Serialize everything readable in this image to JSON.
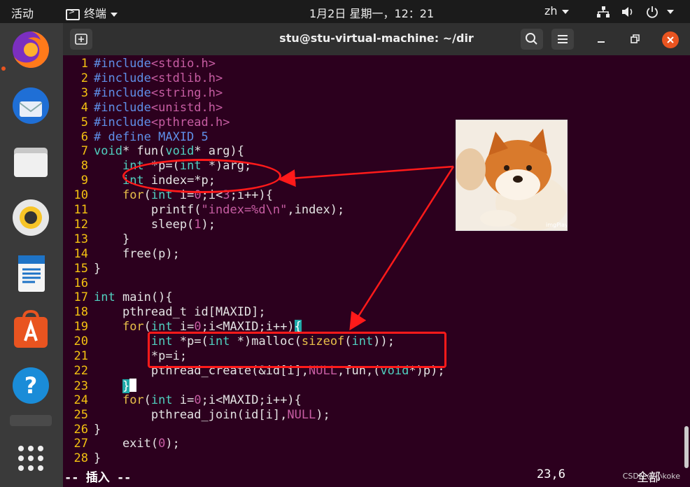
{
  "topbar": {
    "activities": "活动",
    "app_menu": "终端",
    "clock": "1月2日 星期一，12：21",
    "language": "zh"
  },
  "window": {
    "title": "stu@stu-virtual-machine: ~/dir"
  },
  "code": {
    "lines": [
      {
        "n": "1",
        "parts": [
          [
            "pre",
            "#include"
          ],
          [
            "hdr",
            "<stdio.h>"
          ]
        ]
      },
      {
        "n": "2",
        "parts": [
          [
            "pre",
            "#include"
          ],
          [
            "hdr",
            "<stdlib.h>"
          ]
        ]
      },
      {
        "n": "3",
        "parts": [
          [
            "pre",
            "#include"
          ],
          [
            "hdr",
            "<string.h>"
          ]
        ]
      },
      {
        "n": "4",
        "parts": [
          [
            "pre",
            "#include"
          ],
          [
            "hdr",
            "<unistd.h>"
          ]
        ]
      },
      {
        "n": "5",
        "parts": [
          [
            "pre",
            "#include"
          ],
          [
            "hdr",
            "<pthread.h>"
          ]
        ]
      },
      {
        "n": "6",
        "parts": [
          [
            "pre",
            "# define MAXID 5"
          ]
        ]
      },
      {
        "n": "7",
        "parts": [
          [
            "typ",
            "void"
          ],
          [
            "",
            "* fun("
          ],
          [
            "typ",
            "void"
          ],
          [
            "",
            "* arg){"
          ]
        ]
      },
      {
        "n": "8",
        "parts": [
          [
            "",
            "    "
          ],
          [
            "typ",
            "int"
          ],
          [
            "",
            " *p=("
          ],
          [
            "typ",
            "int"
          ],
          [
            "",
            " *)arg;"
          ]
        ]
      },
      {
        "n": "9",
        "parts": [
          [
            "",
            "    "
          ],
          [
            "typ",
            "int"
          ],
          [
            "",
            " index=*p;"
          ]
        ]
      },
      {
        "n": "10",
        "parts": [
          [
            "",
            "    "
          ],
          [
            "kw",
            "for"
          ],
          [
            "",
            "("
          ],
          [
            "typ",
            "int"
          ],
          [
            "",
            " i="
          ],
          [
            "num",
            "0"
          ],
          [
            "",
            ";i<"
          ],
          [
            "num",
            "3"
          ],
          [
            "",
            ";i++){"
          ]
        ]
      },
      {
        "n": "11",
        "parts": [
          [
            "",
            "        printf("
          ],
          [
            "str",
            "\"index=%d\\n\""
          ],
          [
            "",
            ",index);"
          ]
        ]
      },
      {
        "n": "12",
        "parts": [
          [
            "",
            "        sleep("
          ],
          [
            "num",
            "1"
          ],
          [
            "",
            ");"
          ]
        ]
      },
      {
        "n": "13",
        "parts": [
          [
            "",
            "    }"
          ]
        ]
      },
      {
        "n": "14",
        "parts": [
          [
            "",
            "    free(p);"
          ]
        ]
      },
      {
        "n": "15",
        "parts": [
          [
            "",
            "}"
          ]
        ]
      },
      {
        "n": "16",
        "parts": []
      },
      {
        "n": "17",
        "parts": [
          [
            "typ",
            "int"
          ],
          [
            "",
            " main(){"
          ]
        ]
      },
      {
        "n": "18",
        "parts": [
          [
            "",
            "    pthread_t id[MAXID];"
          ]
        ]
      },
      {
        "n": "19",
        "parts": [
          [
            "",
            "    "
          ],
          [
            "kw",
            "for"
          ],
          [
            "",
            "("
          ],
          [
            "typ",
            "int"
          ],
          [
            "",
            " i="
          ],
          [
            "num",
            "0"
          ],
          [
            "",
            ";i<MAXID;i++)"
          ],
          [
            "cursor-br",
            "{"
          ]
        ]
      },
      {
        "n": "20",
        "parts": [
          [
            "",
            "        "
          ],
          [
            "typ",
            "int"
          ],
          [
            "",
            " *p=("
          ],
          [
            "typ",
            "int"
          ],
          [
            "",
            " *)malloc("
          ],
          [
            "kw",
            "sizeof"
          ],
          [
            "",
            "("
          ],
          [
            "typ",
            "int"
          ],
          [
            "",
            "));"
          ]
        ]
      },
      {
        "n": "21",
        "parts": [
          [
            "",
            "        *p=i;"
          ]
        ]
      },
      {
        "n": "22",
        "parts": [
          [
            "",
            "        pthread_create(&id[i],"
          ],
          [
            "num",
            "NULL"
          ],
          [
            "",
            ",fun,("
          ],
          [
            "typ",
            "void"
          ],
          [
            "",
            "*)p);"
          ]
        ]
      },
      {
        "n": "23",
        "parts": [
          [
            "",
            "    "
          ],
          [
            "cursor-br",
            "}"
          ],
          [
            "block",
            ""
          ]
        ]
      },
      {
        "n": "24",
        "parts": [
          [
            "",
            "    "
          ],
          [
            "kw",
            "for"
          ],
          [
            "",
            "("
          ],
          [
            "typ",
            "int"
          ],
          [
            "",
            " i="
          ],
          [
            "num",
            "0"
          ],
          [
            "",
            ";i<MAXID;i++){"
          ]
        ]
      },
      {
        "n": "25",
        "parts": [
          [
            "",
            "        pthread_join(id[i],"
          ],
          [
            "num",
            "NULL"
          ],
          [
            "",
            ");"
          ]
        ]
      },
      {
        "n": "26",
        "parts": [
          [
            "",
            "}"
          ]
        ]
      },
      {
        "n": "27",
        "parts": [
          [
            "",
            "    exit("
          ],
          [
            "num",
            "0"
          ],
          [
            "",
            ");"
          ]
        ]
      },
      {
        "n": "28",
        "parts": [
          [
            "",
            "}"
          ]
        ]
      }
    ]
  },
  "statusline": {
    "mode": "-- 插入 --",
    "position": "23,6",
    "scroll": "全部"
  },
  "overlay": {
    "watermark": "CSDN @小koke"
  },
  "colors": {
    "accent": "#e95420",
    "annotation": "#ff1a1a",
    "terminal_bg": "#2c001e"
  }
}
